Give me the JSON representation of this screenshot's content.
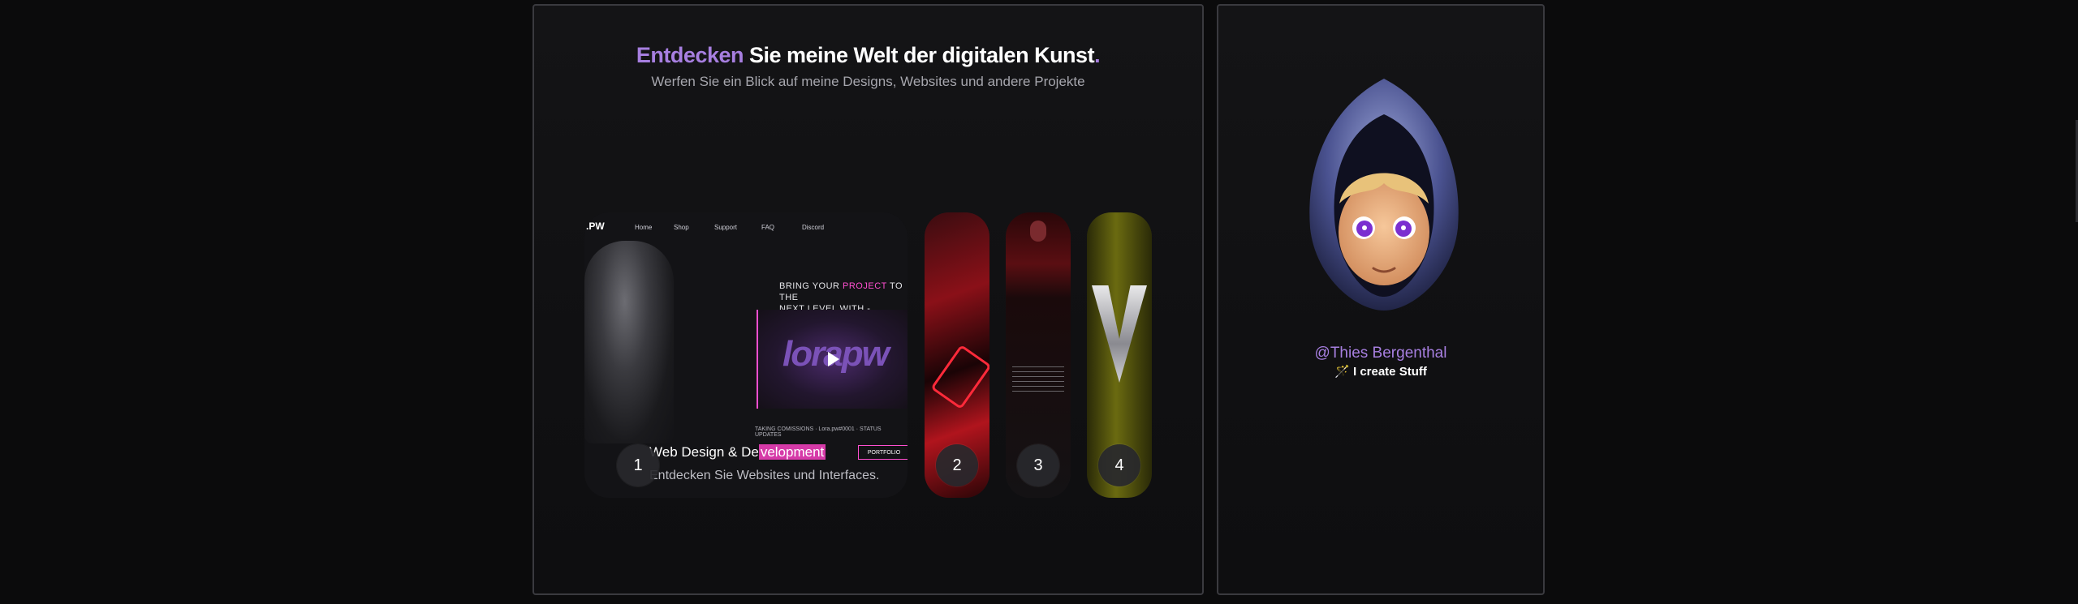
{
  "hero": {
    "title_accent": "Entdecken",
    "title_rest": " Sie meine Welt der digitalen Kunst",
    "title_dot": ".",
    "subtitle": "Werfen Sie ein Blick auf meine Designs, Websites und andere Projekte"
  },
  "projects": [
    {
      "number": "1",
      "title_before": "Web Design & De",
      "title_highlight": "velopment",
      "description": "Entdecken Sie Websites und Interfaces.",
      "mock": {
        "logo": ".PW",
        "nav": [
          "Home",
          "Shop",
          "Support",
          "FAQ",
          "Discord"
        ],
        "headline_line1_a": "BRING YOUR ",
        "headline_line1_pink": "PROJECT",
        "headline_line1_b": " TO THE",
        "headline_line2": "NEXT LEVEL WITH - LORA.PW",
        "video_logo": "lorapw",
        "footer": "TAKING COMISSIONS · Lora.pw#0001 · STATUS UPDATES",
        "portfolio_button": "PORTFOLIO"
      }
    },
    {
      "number": "2"
    },
    {
      "number": "3"
    },
    {
      "number": "4"
    }
  ],
  "profile": {
    "handle": "@Thies Bergenthal",
    "tagline": "🪄 I create Stuff"
  },
  "colors": {
    "accent": "#a77fe0",
    "highlight": "#d63aa8",
    "background": "#0b0b0c"
  }
}
